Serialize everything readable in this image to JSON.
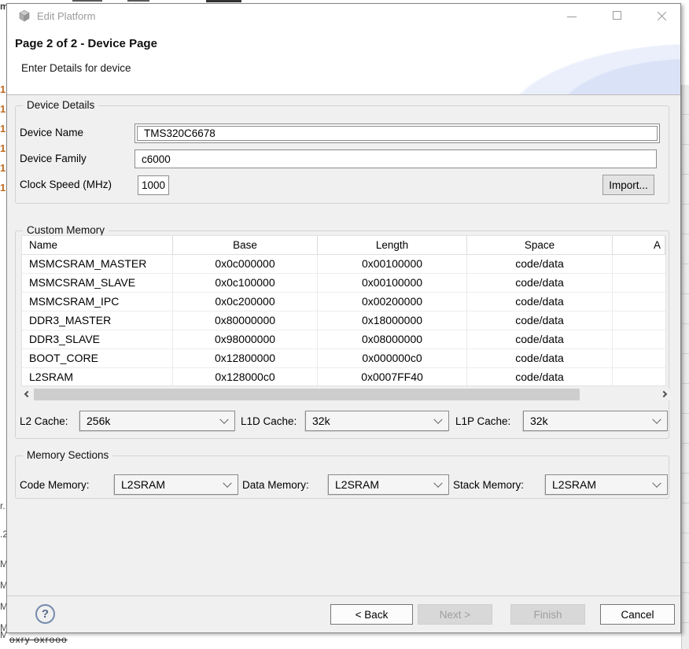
{
  "window": {
    "title": "Edit Platform"
  },
  "header": {
    "title": "Page 2 of 2 - Device Page",
    "subtitle": "Enter Details for device"
  },
  "device_details": {
    "legend": "Device Details",
    "name_label": "Device Name",
    "name_value": "TMS320C6678",
    "family_label": "Device Family",
    "family_value": "c6000",
    "clock_label": "Clock Speed (MHz)",
    "clock_value": "1000",
    "import_label": "Import..."
  },
  "custom_memory": {
    "legend": "Custom Memory",
    "columns": [
      "Name",
      "Base",
      "Length",
      "Space",
      "A"
    ],
    "rows": [
      [
        "MSMCSRAM_MASTER",
        "0x0c000000",
        "0x00100000",
        "code/data"
      ],
      [
        "MSMCSRAM_SLAVE",
        "0x0c100000",
        "0x00100000",
        "code/data"
      ],
      [
        "MSMCSRAM_IPC",
        "0x0c200000",
        "0x00200000",
        "code/data"
      ],
      [
        "DDR3_MASTER",
        "0x80000000",
        "0x18000000",
        "code/data"
      ],
      [
        "DDR3_SLAVE",
        "0x98000000",
        "0x08000000",
        "code/data"
      ],
      [
        "BOOT_CORE",
        "0x12800000",
        "0x000000c0",
        "code/data"
      ],
      [
        "L2SRAM",
        "0x128000c0",
        "0x0007FF40",
        "code/data"
      ]
    ]
  },
  "caches": {
    "l2_label": "L2 Cache:",
    "l2_value": "256k",
    "l1d_label": "L1D Cache:",
    "l1d_value": "32k",
    "l1p_label": "L1P Cache:",
    "l1p_value": "32k"
  },
  "memory_sections": {
    "legend": "Memory Sections",
    "code_label": "Code Memory:",
    "code_value": "L2SRAM",
    "data_label": "Data Memory:",
    "data_value": "L2SRAM",
    "stack_label": "Stack Memory:",
    "stack_value": "L2SRAM"
  },
  "footer": {
    "help": "?",
    "back": "< Back",
    "next": "Next >",
    "finish": "Finish",
    "cancel": "Cancel"
  },
  "icons": {
    "app": "cube",
    "minimize": "minus",
    "maximize": "square",
    "close": "x",
    "combo_chevron": "chevron-down",
    "scroll_left": "chevron-left",
    "scroll_right": "chevron-right",
    "help": "?"
  },
  "colors": {
    "banner_accent": "#d9e2f6",
    "content_bg": "#f0f0f0",
    "field_border": "#8c8c8c",
    "disabled_text": "#9e9e9e",
    "backdrop_digit": "#bf6a1e"
  },
  "backdrop": {
    "top_left_char": "m",
    "left_digits": [
      "1",
      "1",
      "1",
      "1",
      "1",
      "1"
    ],
    "left_letters": [
      "r.",
      ".2",
      "M",
      "M",
      "M",
      "M"
    ],
    "bottom_left_char": "M",
    "bottom_text": "oxry oxrooo"
  }
}
